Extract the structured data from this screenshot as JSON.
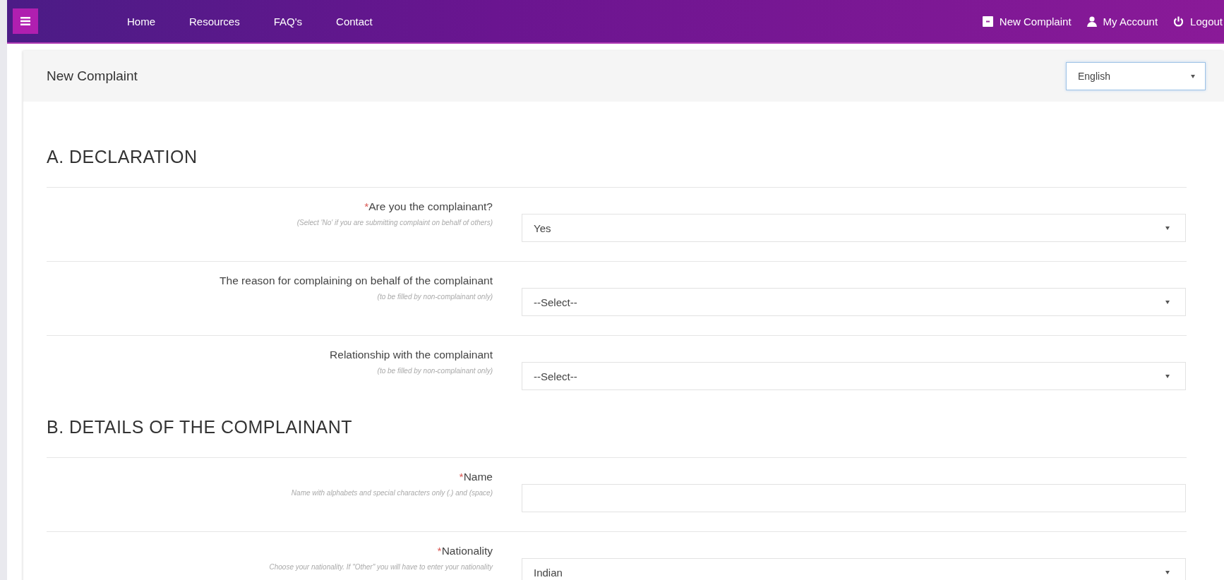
{
  "navbar": {
    "links": [
      "Home",
      "Resources",
      "FAQ's",
      "Contact"
    ],
    "actions": [
      {
        "label": "New Complaint",
        "kind": "complaint"
      },
      {
        "label": "My Account",
        "kind": "account"
      },
      {
        "label": "Logout",
        "kind": "logout"
      }
    ]
  },
  "header": {
    "title": "New Complaint",
    "language": "English"
  },
  "sections": [
    {
      "heading": "A. DECLARATION",
      "fields": [
        {
          "kind": "select",
          "required_mark": "*",
          "label": "Are you the complainant?",
          "hint": "(Select 'No' if you are submitting complaint on behalf of others)",
          "value": "Yes"
        },
        {
          "kind": "select",
          "label": "The reason for complaining on behalf of the complainant",
          "hint": "(to be filled by non-complainant only)",
          "value": "--Select--"
        },
        {
          "kind": "select",
          "label": "Relationship with the complainant",
          "hint": "(to be filled by non-complainant only)",
          "value": "--Select--"
        }
      ]
    },
    {
      "heading": "B. DETAILS OF THE COMPLAINANT",
      "fields": [
        {
          "kind": "text",
          "required_mark": "*",
          "label": "Name",
          "hint": "Name with alphabets and special characters only (.) and (space)"
        },
        {
          "kind": "select",
          "required_mark": "*",
          "label": "Nationality",
          "hint": "Choose your nationality. If \"Other\" you will have to enter your nationality",
          "value": "Indian"
        }
      ]
    }
  ]
}
